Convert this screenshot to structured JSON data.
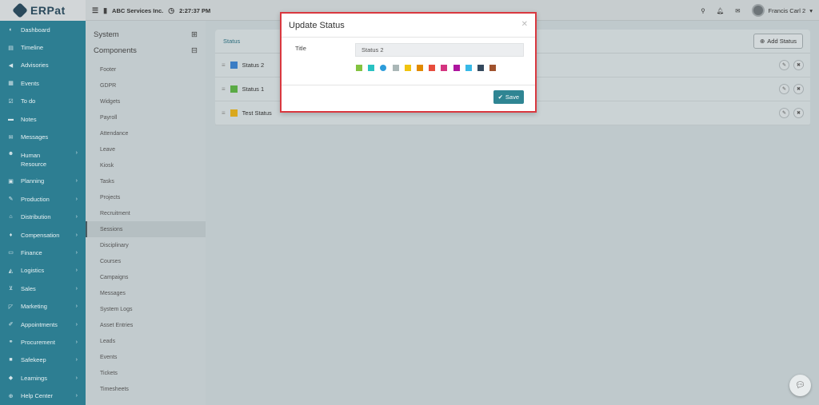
{
  "app": {
    "logo_text": "ERPat"
  },
  "topbar": {
    "company": "ABC Services Inc.",
    "time": "2:27:37 PM",
    "user_name": "Francis Carl 2"
  },
  "sidebar": {
    "items": [
      {
        "label": "Dashboard",
        "icon": "dashboard-icon",
        "chevron": false
      },
      {
        "label": "Timeline",
        "icon": "timeline-icon",
        "chevron": false
      },
      {
        "label": "Advisories",
        "icon": "megaphone-icon",
        "chevron": false
      },
      {
        "label": "Events",
        "icon": "calendar-icon",
        "chevron": false
      },
      {
        "label": "To do",
        "icon": "checkbox-icon",
        "chevron": false
      },
      {
        "label": "Notes",
        "icon": "note-icon",
        "chevron": false
      },
      {
        "label": "Messages",
        "icon": "envelope-icon",
        "chevron": false
      },
      {
        "label": "Human\nResource",
        "icon": "users-icon",
        "chevron": true
      },
      {
        "label": "Planning",
        "icon": "briefcase-icon",
        "chevron": true
      },
      {
        "label": "Production",
        "icon": "wrench-icon",
        "chevron": true
      },
      {
        "label": "Distribution",
        "icon": "bank-icon",
        "chevron": true
      },
      {
        "label": "Compensation",
        "icon": "money-icon",
        "chevron": true
      },
      {
        "label": "Finance",
        "icon": "wallet-icon",
        "chevron": true
      },
      {
        "label": "Logistics",
        "icon": "truck-icon",
        "chevron": true
      },
      {
        "label": "Sales",
        "icon": "cart-icon",
        "chevron": true
      },
      {
        "label": "Marketing",
        "icon": "chart-icon",
        "chevron": true
      },
      {
        "label": "Appointments",
        "icon": "edit-icon",
        "chevron": true
      },
      {
        "label": "Procurement",
        "icon": "handshake-icon",
        "chevron": true
      },
      {
        "label": "Safekeep",
        "icon": "box-icon",
        "chevron": true
      },
      {
        "label": "Learnings",
        "icon": "graduation-icon",
        "chevron": true
      },
      {
        "label": "Help Center",
        "icon": "lifebuoy-icon",
        "chevron": true
      }
    ]
  },
  "subnav": {
    "system_label": "System",
    "components_label": "Components",
    "items": [
      "Footer",
      "GDPR",
      "Widgets",
      "Payroll",
      "Attendance",
      "Leave",
      "Kiosk",
      "Tasks",
      "Projects",
      "Recruitment",
      "Sessions",
      "Disciplinary",
      "Courses",
      "Campaigns",
      "Messages",
      "System Logs",
      "Asset Entries",
      "Leads",
      "Events",
      "Tickets",
      "Timesheets"
    ],
    "active": "Sessions"
  },
  "panel": {
    "tab_label": "Status",
    "add_button": "Add Status",
    "rows": [
      {
        "title": "Status 2",
        "color": "#3b7dc4"
      },
      {
        "title": "Status 1",
        "color": "#5aaa45"
      },
      {
        "title": "Test Status",
        "color": "#d9a81e"
      }
    ]
  },
  "modal": {
    "title": "Update Status",
    "field_label": "Title",
    "field_value": "Status 2",
    "save_label": "Save",
    "colors": [
      "#83c340",
      "#29c2c2",
      "#2d9cdb",
      "#aab7b7",
      "#f1c40f",
      "#e18a00",
      "#e74c3c",
      "#d43480",
      "#ad159e",
      "#37b9e7",
      "#34495e",
      "#a0522d"
    ],
    "selected_color_index": 2
  }
}
